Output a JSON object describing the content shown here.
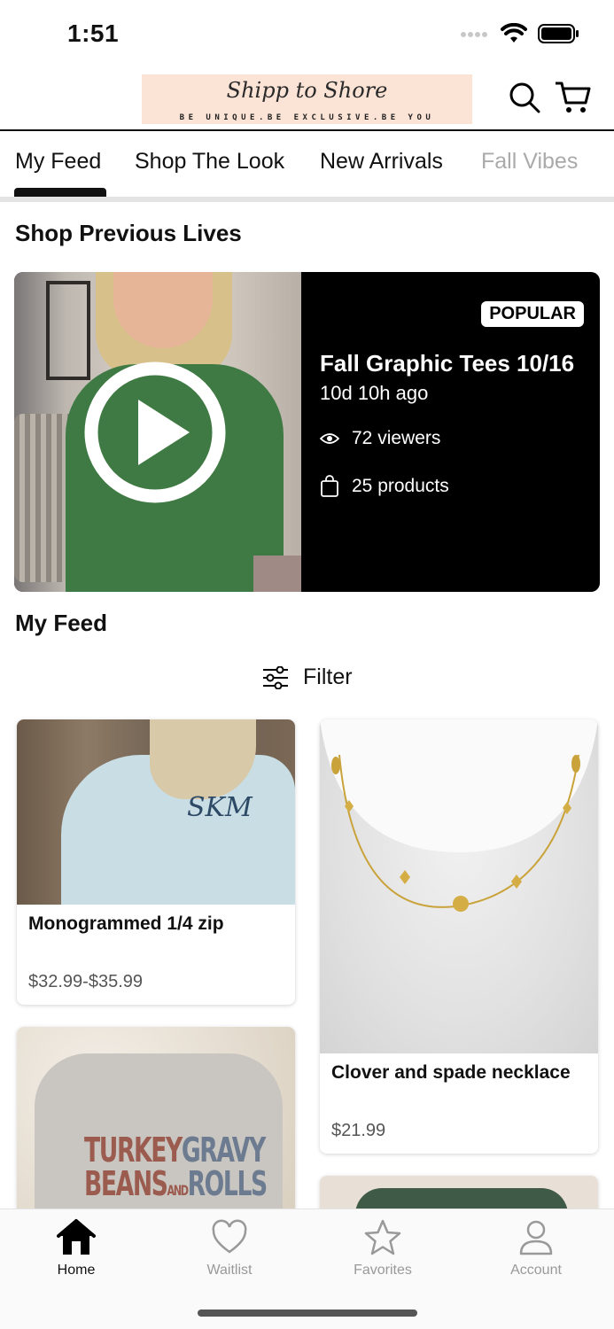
{
  "status_bar": {
    "time": "1:51"
  },
  "header": {
    "logo_script": "Shipp to Shore",
    "logo_tagline": "BE UNIQUE.BE EXCLUSIVE.BE YOU"
  },
  "tabs": [
    {
      "label": "My Feed",
      "active": true
    },
    {
      "label": "Shop The Look",
      "active": false
    },
    {
      "label": "New Arrivals",
      "active": false
    },
    {
      "label": "Fall Vibes",
      "active": false
    }
  ],
  "previous_lives": {
    "title": "Shop Previous Lives",
    "card": {
      "badge": "POPULAR",
      "title": "Fall Graphic Tees 10/16",
      "ago": "10d 10h ago",
      "viewers": "72 viewers",
      "products": "25 products"
    }
  },
  "feed": {
    "title": "My Feed",
    "filter_label": "Filter",
    "products": [
      {
        "name": "Monogrammed 1/4 zip",
        "price": "$32.99-$35.99",
        "monogram": "SKM"
      },
      {
        "name": "Clover and spade necklace",
        "price": "$21.99"
      },
      {
        "name": "",
        "price": "",
        "shirt_text_1": "TURKEY",
        "shirt_text_2": "GRAVY",
        "shirt_text_3": "BEANS",
        "shirt_text_4": "AND",
        "shirt_text_5": "ROLLS"
      },
      {
        "name": "",
        "price": ""
      }
    ]
  },
  "tabbar": [
    {
      "label": "Home",
      "icon": "home-icon",
      "active": true
    },
    {
      "label": "Waitlist",
      "icon": "heart-icon",
      "active": false
    },
    {
      "label": "Favorites",
      "icon": "star-icon",
      "active": false
    },
    {
      "label": "Account",
      "icon": "person-icon",
      "active": false
    }
  ],
  "colors": {
    "logo_bg": "#fbe3d6",
    "accent": "#111111",
    "live_card_bg": "#000000"
  }
}
